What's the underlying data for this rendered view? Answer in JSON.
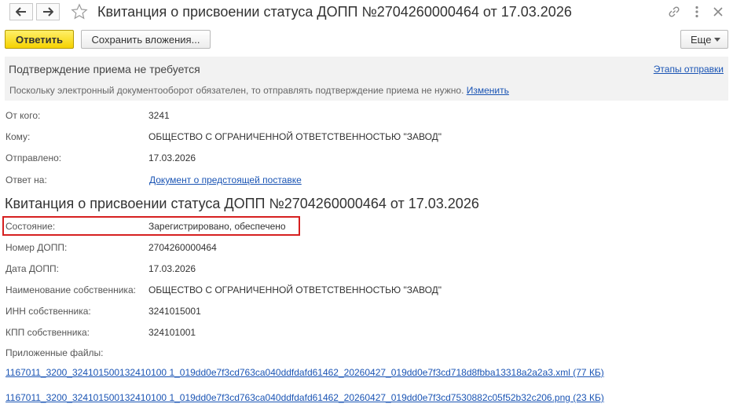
{
  "window": {
    "title": "Квитанция о присвоении статуса ДОПП №2704260000464 от 17.03.2026"
  },
  "toolbar": {
    "reply_label": "Ответить",
    "save_attachments_label": "Сохранить вложения...",
    "more_label": "Еще"
  },
  "notice": {
    "heading": "Подтверждение приема не требуется",
    "stages_link": "Этапы отправки",
    "text": "Поскольку электронный документооборот обязателен, то отправлять подтверждение приема не нужно.",
    "change_link": "Изменить"
  },
  "meta": {
    "from_label": "От кого:",
    "from_value": "3241",
    "to_label": "Кому:",
    "to_value": "ОБЩЕСТВО С ОГРАНИЧЕННОЙ ОТВЕТСТВЕННОСТЬЮ \"ЗАВОД\"",
    "sent_label": "Отправлено:",
    "sent_value": "17.03.2026",
    "reply_to_label": "Ответ на:",
    "reply_to_link": "Документ о предстоящей поставке"
  },
  "document": {
    "heading": "Квитанция о присвоении статуса ДОПП №2704260000464 от 17.03.2026",
    "state_label": "Состояние:",
    "state_value": "Зарегистрировано, обеспечено",
    "number_label": "Номер ДОПП:",
    "number_value": "2704260000464",
    "date_label": "Дата ДОПП:",
    "date_value": "17.03.2026",
    "owner_name_label": "Наименование собственника:",
    "owner_name_value": "ОБЩЕСТВО С ОГРАНИЧЕННОЙ ОТВЕТСТВЕННОСТЬЮ \"ЗАВОД\"",
    "inn_label": "ИНН собственника:",
    "inn_value": "3241015001",
    "kpp_label": "КПП собственника:",
    "kpp_value": "324101001",
    "files_label": "Приложенные файлы:",
    "files": [
      "1167011_3200_324101500132410100 1_019dd0e7f3cd763ca040ddfdafd61462_20260427_019dd0e7f3cd718d8fbba13318a2a2a3.xml (77 КБ)",
      "1167011_3200_324101500132410100 1_019dd0e7f3cd763ca040ddfdafd61462_20260427_019dd0e7f3cd7530882c05f52b32c206.png (23 КБ)"
    ]
  },
  "colors": {
    "accent_yellow": "#f5d200",
    "link_blue": "#1a54b4",
    "highlight_red": "#d62020",
    "notice_bg": "#f2f2f2"
  }
}
